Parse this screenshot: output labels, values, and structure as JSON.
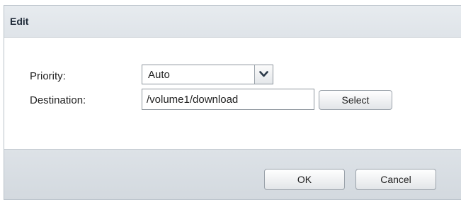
{
  "dialog": {
    "title": "Edit"
  },
  "form": {
    "priority": {
      "label": "Priority:",
      "selected": "Auto",
      "arrow_icon": "chevron-down-icon"
    },
    "destination": {
      "label": "Destination:",
      "value": "/volume1/download",
      "select_button": "Select"
    }
  },
  "footer": {
    "ok_label": "OK",
    "cancel_label": "Cancel"
  }
}
